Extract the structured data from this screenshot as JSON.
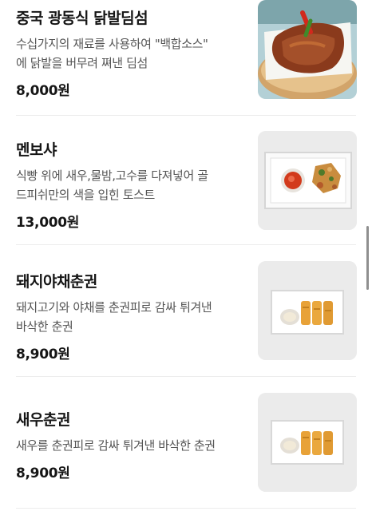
{
  "menu": {
    "items": [
      {
        "name": "중국 광동식 닭발딤섬",
        "description_lines": [
          "수십가지의 재료를 사용하여 \"백합소스\"",
          "에 닭발을 버무려 쪄낸 딤섬"
        ],
        "price": "8,000원",
        "image_icon": "chicken-feet-dimsum-photo"
      },
      {
        "name": "멘보샤",
        "description_lines": [
          "식빵 위에 새우,물밤,고수를 다져넣어 골",
          "드피쉬만의 색을 입힌 토스트"
        ],
        "price": "13,000원",
        "image_icon": "menbosha-photo"
      },
      {
        "name": "돼지야채춘권",
        "description_lines": [
          "돼지고기와 야채를 춘권피로 감싸 튀겨낸",
          "바삭한 춘권"
        ],
        "price": "8,900원",
        "image_icon": "pork-spring-roll-photo"
      },
      {
        "name": "새우춘권",
        "description_lines": [
          "새우를 춘권피로 감싸 튀겨낸 바삭한 춘권"
        ],
        "price": "8,900원",
        "image_icon": "shrimp-spring-roll-photo"
      }
    ]
  }
}
